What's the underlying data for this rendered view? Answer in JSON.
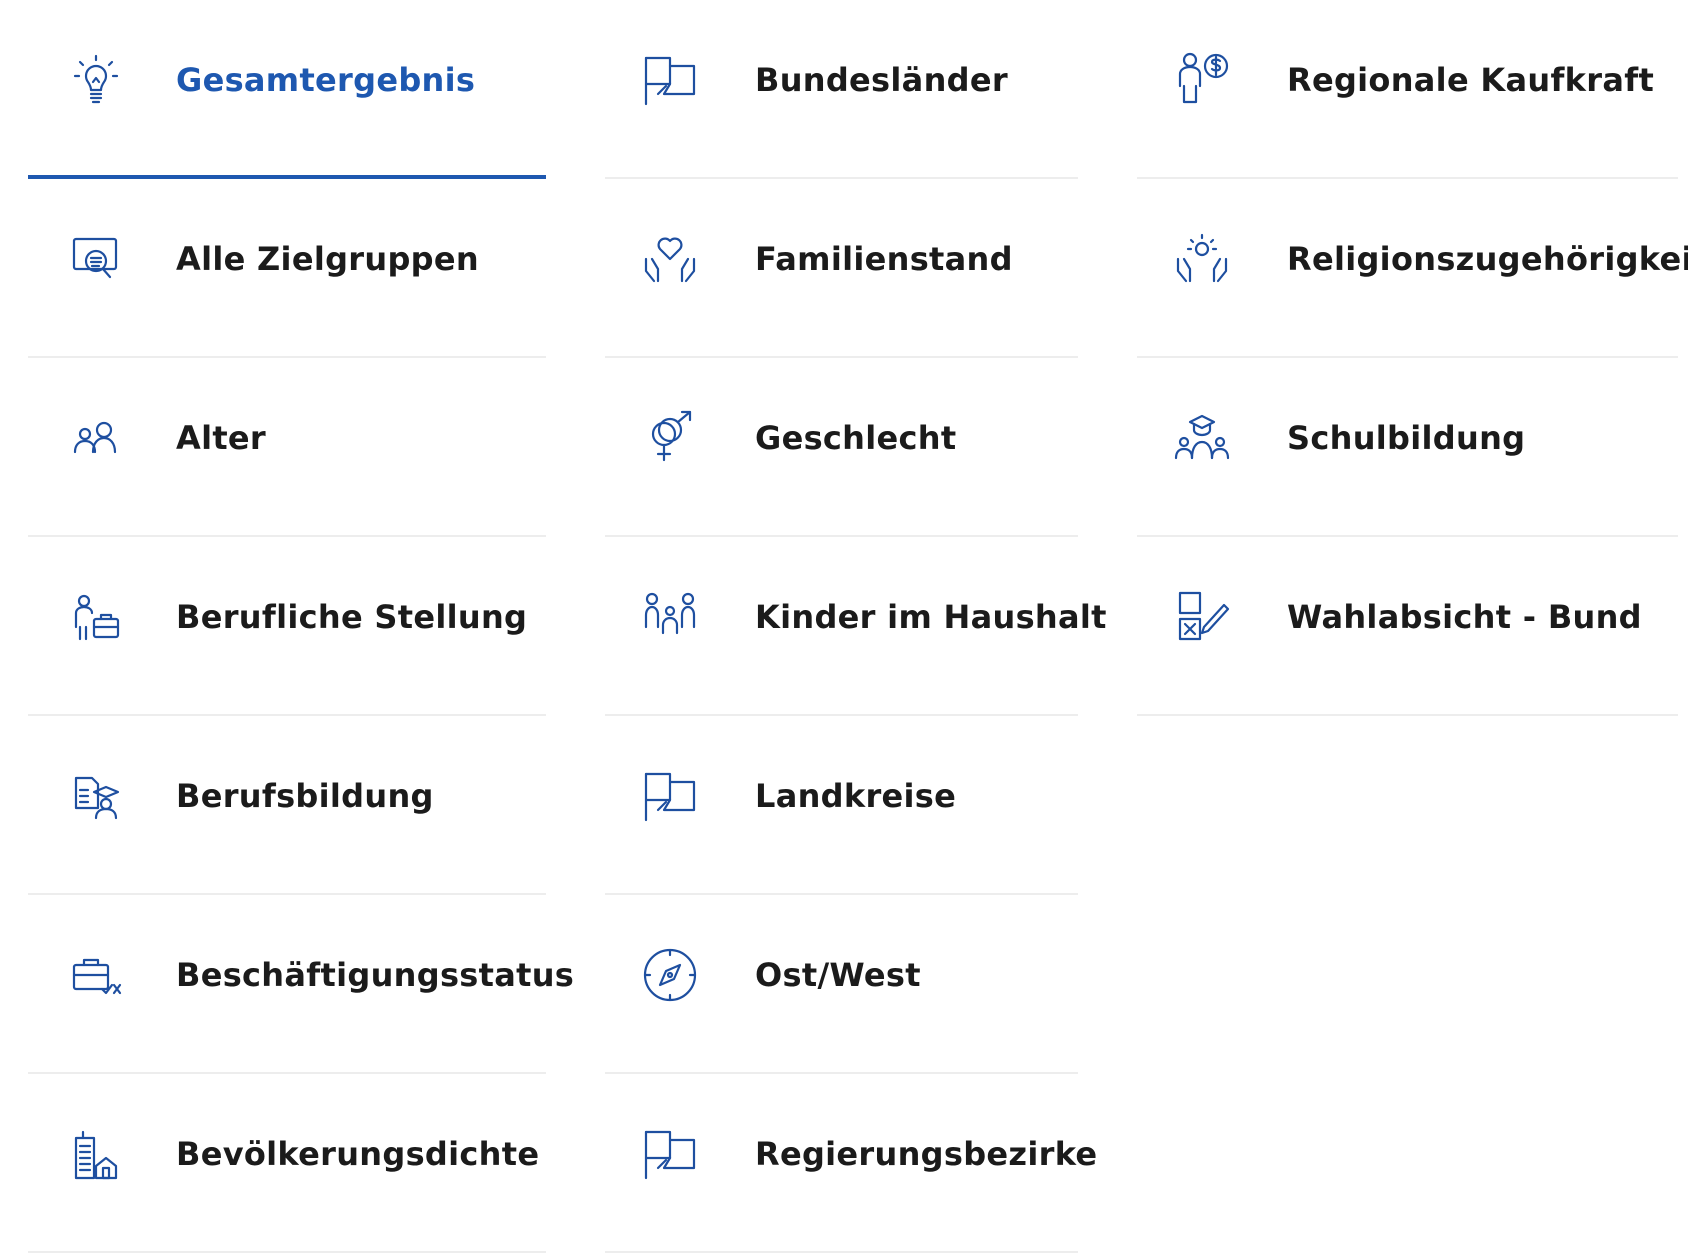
{
  "accent_color": "#1e58b0",
  "icon_color": "#1e4fa0",
  "text_color": "#1b1b1b",
  "columns": [
    [
      {
        "label": "Gesamtergebnis",
        "icon": "lightbulb-icon",
        "active": true
      },
      {
        "label": "Alle Zielgruppen",
        "icon": "monitor-search-icon"
      },
      {
        "label": "Alter",
        "icon": "people-icon"
      },
      {
        "label": "Berufliche Stellung",
        "icon": "person-briefcase-icon"
      },
      {
        "label": "Berufsbildung",
        "icon": "document-graduate-icon"
      },
      {
        "label": "Beschäftigungsstatus",
        "icon": "briefcase-check-icon"
      },
      {
        "label": "Bevölkerungsdichte",
        "icon": "building-house-icon"
      }
    ],
    [
      {
        "label": "Bundesländer",
        "icon": "map-icon"
      },
      {
        "label": "Familienstand",
        "icon": "hands-heart-icon"
      },
      {
        "label": "Geschlecht",
        "icon": "gender-icon"
      },
      {
        "label": "Kinder im Haushalt",
        "icon": "family-icon"
      },
      {
        "label": "Landkreise",
        "icon": "map-icon"
      },
      {
        "label": "Ost/West",
        "icon": "compass-icon"
      },
      {
        "label": "Regierungsbezirke",
        "icon": "map-icon"
      }
    ],
    [
      {
        "label": "Regionale Kaufkraft",
        "icon": "person-money-icon"
      },
      {
        "label": "Religionszugehörigkeit",
        "icon": "hands-sun-icon"
      },
      {
        "label": "Schulbildung",
        "icon": "graduates-icon"
      },
      {
        "label": "Wahlabsicht - Bund",
        "icon": "ballot-pen-icon"
      }
    ]
  ]
}
